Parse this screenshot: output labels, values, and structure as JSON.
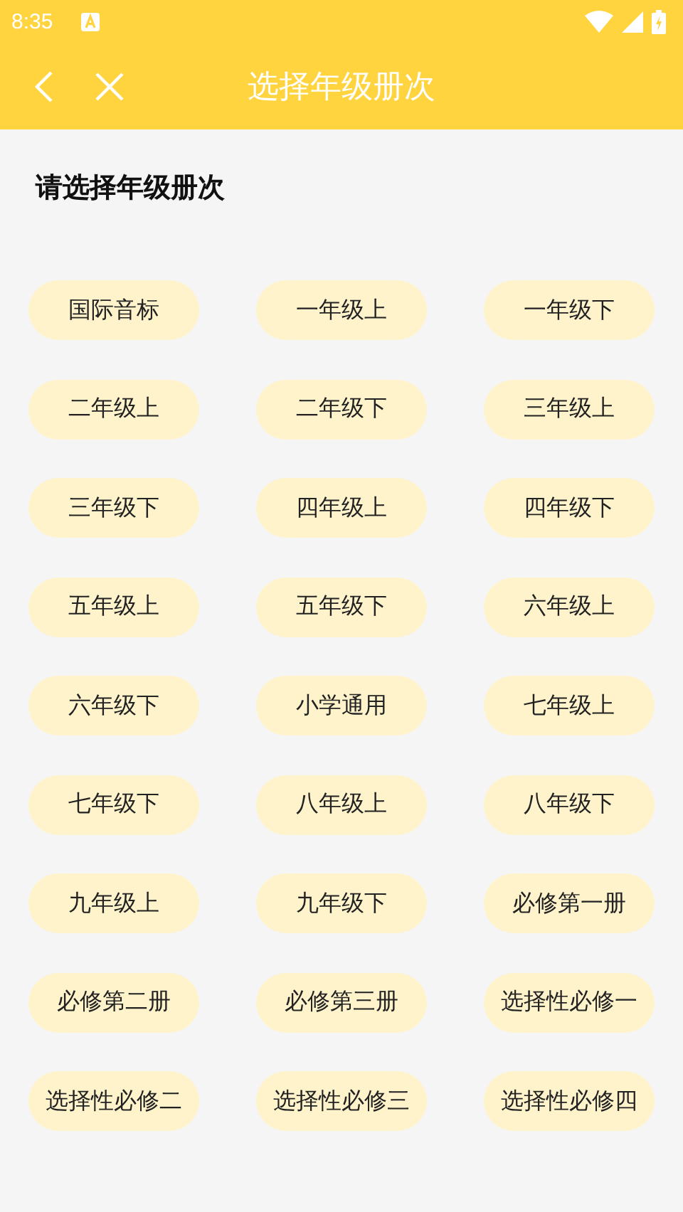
{
  "status_bar": {
    "time": "8:35"
  },
  "toolbar": {
    "title": "选择年级册次"
  },
  "heading": "请选择年级册次",
  "grades": [
    "国际音标",
    "一年级上",
    "一年级下",
    "二年级上",
    "二年级下",
    "三年级上",
    "三年级下",
    "四年级上",
    "四年级下",
    "五年级上",
    "五年级下",
    "六年级上",
    "六年级下",
    "小学通用",
    "七年级上",
    "七年级下",
    "八年级上",
    "八年级下",
    "九年级上",
    "九年级下",
    "必修第一册",
    "必修第二册",
    "必修第三册",
    "选择性必修一",
    "选择性必修二",
    "选择性必修三",
    "选择性必修四"
  ]
}
